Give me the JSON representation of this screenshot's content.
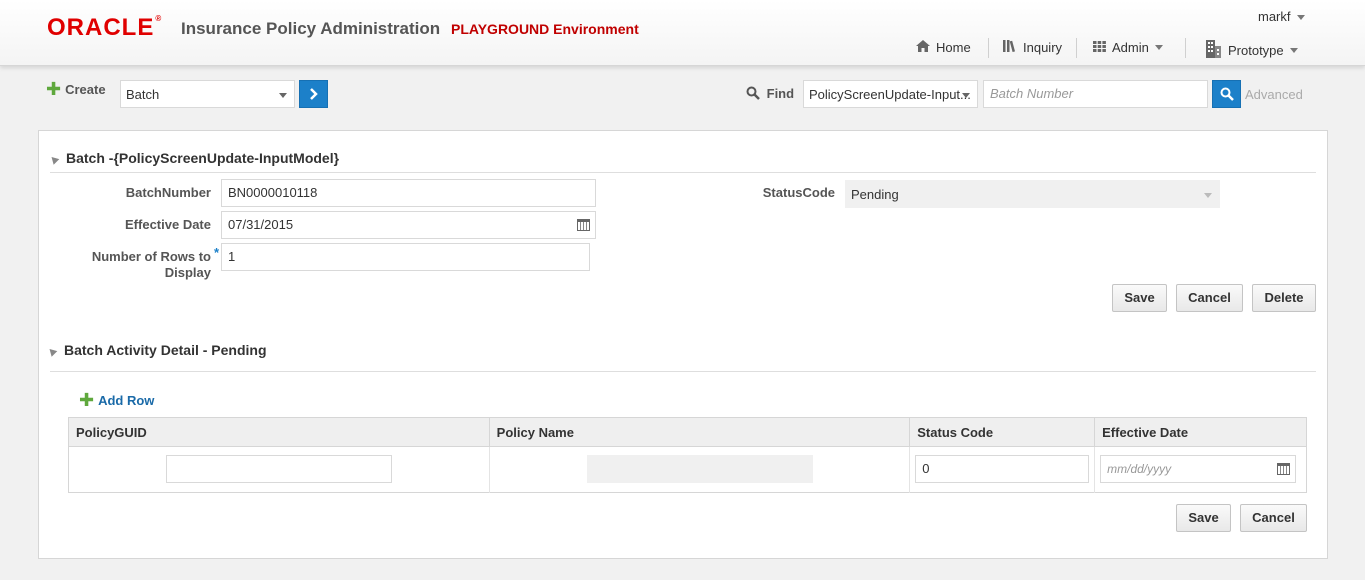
{
  "header": {
    "logo": "ORACLE",
    "app_title": "Insurance Policy Administration",
    "environment": "PLAYGROUND Environment",
    "user": "markf",
    "nav": {
      "home": "Home",
      "inquiry": "Inquiry",
      "admin": "Admin",
      "prototype": "Prototype"
    }
  },
  "toolbar": {
    "create_label": "Create",
    "create_value": "Batch",
    "find_label": "Find",
    "find_value": "PolicyScreenUpdate-Input...",
    "search_placeholder": "Batch Number",
    "advanced_label": "Advanced"
  },
  "batch": {
    "title": "Batch -{PolicyScreenUpdate-InputModel}",
    "batch_number_label": "BatchNumber",
    "batch_number_value": "BN0000010118",
    "effective_date_label": "Effective Date",
    "effective_date_value": "07/31/2015",
    "rows_label_1": "Number of Rows to",
    "rows_label_2": "Display",
    "required_mark": "*",
    "rows_value": "1",
    "status_label": "StatusCode",
    "status_value": "Pending",
    "save": "Save",
    "cancel": "Cancel",
    "delete": "Delete"
  },
  "detail": {
    "title": "Batch Activity Detail - Pending",
    "add_row": "Add Row",
    "columns": [
      "PolicyGUID",
      "Policy Name",
      "Status Code",
      "Effective Date"
    ],
    "row": {
      "policy_guid": "",
      "status_code": "0",
      "effective_date_placeholder": "mm/dd/yyyy"
    },
    "save": "Save",
    "cancel": "Cancel"
  }
}
